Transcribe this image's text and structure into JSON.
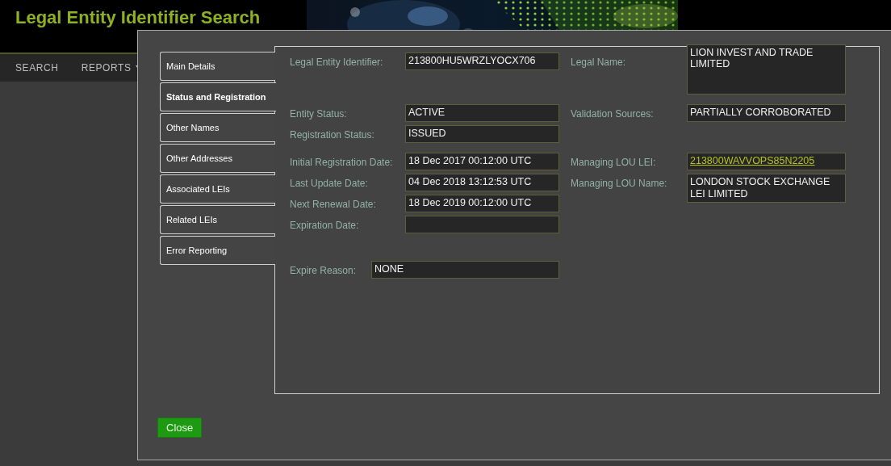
{
  "header": {
    "title": "Legal Entity Identifier Search"
  },
  "nav": [
    {
      "label": "SEARCH",
      "dropdown": false
    },
    {
      "label": "REPORTS",
      "dropdown": true
    }
  ],
  "dialog": {
    "tabs": [
      {
        "label": "Main Details",
        "selected": false
      },
      {
        "label": "Status and Registration",
        "selected": true
      },
      {
        "label": "Other Names",
        "selected": false
      },
      {
        "label": "Other Addresses",
        "selected": false
      },
      {
        "label": "Associated LEIs",
        "selected": false
      },
      {
        "label": "Related LEIs",
        "selected": false
      },
      {
        "label": "Error Reporting",
        "selected": false
      }
    ],
    "sections": [
      {
        "rows": [
          {
            "left": {
              "label": "Legal Entity Identifier:",
              "value": "213800HU5WRZLYOCX706",
              "kind": "text"
            },
            "right": {
              "label": "Legal Name:",
              "value": "LION INVEST AND TRADE LIMITED",
              "kind": "textarea"
            }
          }
        ]
      },
      {
        "rows": [
          {
            "left": {
              "label": "Entity Status:",
              "value": "ACTIVE",
              "kind": "text"
            },
            "right": {
              "label": "Validation Sources:",
              "value": "PARTIALLY CORROBORATED",
              "kind": "text"
            }
          },
          {
            "left": {
              "label": "Registration Status:",
              "value": "ISSUED",
              "kind": "text"
            }
          }
        ]
      },
      {
        "rows": [
          {
            "left": {
              "label": "Initial Registration Date:",
              "value": "18 Dec 2017 00:12:00 UTC",
              "kind": "text"
            },
            "right": {
              "label": "Managing LOU LEI:",
              "value": "213800WAVVOPS85N2205",
              "kind": "link"
            }
          },
          {
            "left": {
              "label": "Last Update Date:",
              "value": "04 Dec 2018 13:12:53 UTC",
              "kind": "text"
            },
            "right": {
              "label": "Managing LOU Name:",
              "value": "LONDON STOCK EXCHANGE LEI LIMITED",
              "kind": "multiline"
            }
          },
          {
            "left": {
              "label": "Next Renewal Date:",
              "value": "18 Dec 2019 00:12:00 UTC",
              "kind": "text"
            }
          },
          {
            "left": {
              "label": "Expiration Date:",
              "kind": "text"
            }
          }
        ]
      },
      {
        "rows": [
          {
            "wide": {
              "label": "Expire Reason:",
              "value": "NONE",
              "kind": "text"
            }
          }
        ]
      }
    ],
    "close_button": "Close"
  }
}
